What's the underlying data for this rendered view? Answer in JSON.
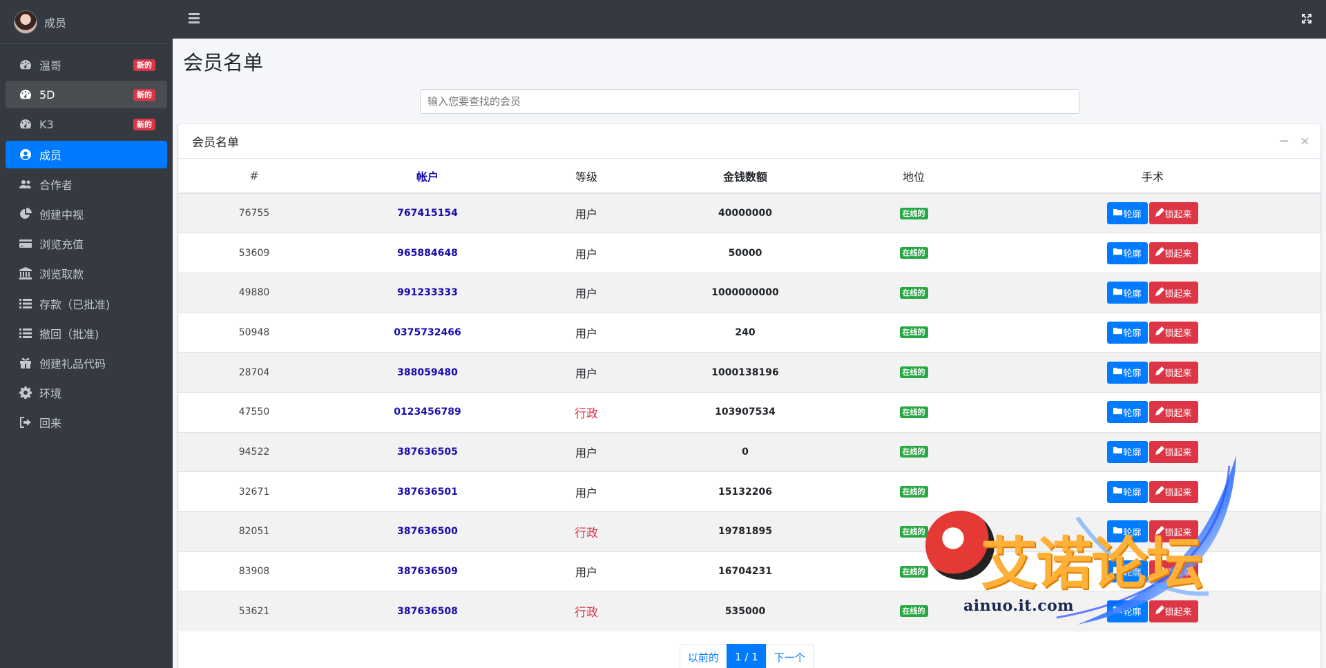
{
  "sidebar": {
    "user": "成员",
    "items": [
      {
        "label": "温哥",
        "badge": "新的",
        "icon": "dashboard-icon",
        "name": "sidebar-item-wen-ge"
      },
      {
        "label": "5D",
        "badge": "新的",
        "icon": "dashboard-icon",
        "name": "sidebar-item-5d"
      },
      {
        "label": "K3",
        "badge": "新的",
        "icon": "dashboard-icon",
        "name": "sidebar-item-k3"
      },
      {
        "label": "成员",
        "badge": "",
        "icon": "user-circle-icon",
        "name": "sidebar-item-members"
      },
      {
        "label": "合作者",
        "badge": "",
        "icon": "users-icon",
        "name": "sidebar-item-partners"
      },
      {
        "label": "创建中视",
        "badge": "",
        "icon": "pie-chart-icon",
        "name": "sidebar-item-create"
      },
      {
        "label": "浏览充值",
        "badge": "",
        "icon": "credit-card-icon",
        "name": "sidebar-item-recharge"
      },
      {
        "label": "浏览取款",
        "badge": "",
        "icon": "bank-icon",
        "name": "sidebar-item-withdraw"
      },
      {
        "label": "存款（已批准)",
        "badge": "",
        "icon": "list-icon",
        "name": "sidebar-item-deposit-approved"
      },
      {
        "label": "撤回（批准)",
        "badge": "",
        "icon": "list-icon",
        "name": "sidebar-item-withdraw-approved"
      },
      {
        "label": "创建礼品代码",
        "badge": "",
        "icon": "gift-icon",
        "name": "sidebar-item-gift-code"
      },
      {
        "label": "环境",
        "badge": "",
        "icon": "gear-icon",
        "name": "sidebar-item-settings"
      },
      {
        "label": "回来",
        "badge": "",
        "icon": "sign-out-icon",
        "name": "sidebar-item-back"
      }
    ]
  },
  "page": {
    "title": "会员名单",
    "search_placeholder": "输入您要查找的会员"
  },
  "card": {
    "title": "会员名单",
    "minimize": "−",
    "close": "×"
  },
  "table": {
    "headers": [
      "#",
      "帐户",
      "等级",
      "金钱数额",
      "地位",
      "手术"
    ],
    "rows": [
      {
        "id": "76755",
        "account": "767415154",
        "level": "用户",
        "admin": false,
        "money": "40000000",
        "status": "在线的"
      },
      {
        "id": "53609",
        "account": "965884648",
        "level": "用户",
        "admin": false,
        "money": "50000",
        "status": "在线的"
      },
      {
        "id": "49880",
        "account": "991233333",
        "level": "用户",
        "admin": false,
        "money": "1000000000",
        "status": "在线的"
      },
      {
        "id": "50948",
        "account": "0375732466",
        "level": "用户",
        "admin": false,
        "money": "240",
        "status": "在线的"
      },
      {
        "id": "28704",
        "account": "388059480",
        "level": "用户",
        "admin": false,
        "money": "1000138196",
        "status": "在线的"
      },
      {
        "id": "47550",
        "account": "0123456789",
        "level": "行政",
        "admin": true,
        "money": "103907534",
        "status": "在线的"
      },
      {
        "id": "94522",
        "account": "387636505",
        "level": "用户",
        "admin": false,
        "money": "0",
        "status": "在线的"
      },
      {
        "id": "32671",
        "account": "387636501",
        "level": "用户",
        "admin": false,
        "money": "15132206",
        "status": "在线的"
      },
      {
        "id": "82051",
        "account": "387636500",
        "level": "行政",
        "admin": true,
        "money": "19781895",
        "status": "在线的"
      },
      {
        "id": "83908",
        "account": "387636509",
        "level": "用户",
        "admin": false,
        "money": "16704231",
        "status": "在线的"
      },
      {
        "id": "53621",
        "account": "387636508",
        "level": "行政",
        "admin": true,
        "money": "535000",
        "status": "在线的"
      }
    ],
    "view_label": "轮廓",
    "lock_label": "锁起来"
  },
  "pagination": {
    "prev": "以前的",
    "current": "1 / 1",
    "next": "下一个"
  },
  "watermark": {
    "text": "艾诺论坛",
    "url": "ainuo.it.com"
  },
  "colors": {
    "sidebar_bg": "#343a40",
    "active": "#007bff",
    "danger": "#dc3545",
    "success": "#28a745"
  }
}
